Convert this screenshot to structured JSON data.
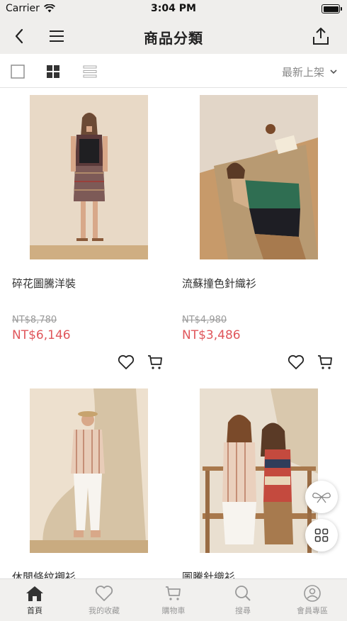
{
  "status_bar": {
    "carrier": "Carrier",
    "time": "3:04 PM"
  },
  "nav": {
    "title": "商品分類"
  },
  "toolbar": {
    "sort_label": "最新上架"
  },
  "products": [
    {
      "name": "碎花圖騰洋裝",
      "original_price": "NT$8,780",
      "sale_price": "NT$6,146"
    },
    {
      "name": "流蘇撞色針織衫",
      "original_price": "NT$4,980",
      "sale_price": "NT$3,486"
    },
    {
      "name": "休閒條紋襯衫"
    },
    {
      "name": "圖騰針織衫"
    }
  ],
  "tabbar": {
    "items": [
      {
        "label": "首頁",
        "icon": "home-icon",
        "active": true
      },
      {
        "label": "我的收藏",
        "icon": "heart-icon",
        "active": false
      },
      {
        "label": "購物車",
        "icon": "cart-icon",
        "active": false
      },
      {
        "label": "搜尋",
        "icon": "search-icon",
        "active": false
      },
      {
        "label": "會員專區",
        "icon": "user-icon",
        "active": false
      }
    ]
  },
  "colors": {
    "accent": "#e0565b",
    "bar_bg": "#efeeec",
    "muted": "#999999"
  }
}
